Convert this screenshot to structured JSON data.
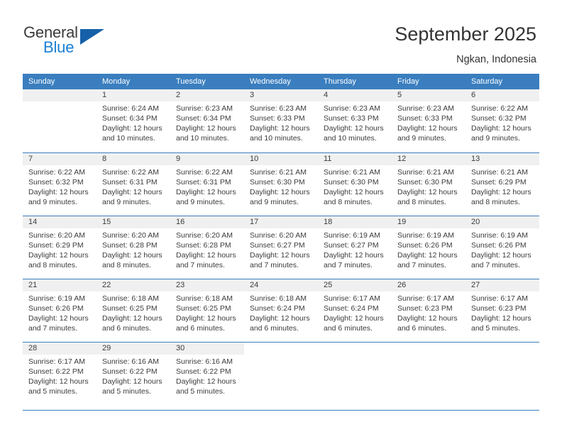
{
  "brand": {
    "name_part1": "General",
    "name_part2": "Blue",
    "accent_color": "#1560a8",
    "accent_text_color": "#1a7fd4"
  },
  "header": {
    "title": "September 2025",
    "location": "Ngkan, Indonesia"
  },
  "calendar": {
    "header_bg": "#3a7ebf",
    "daynum_bg": "#f0f0f0",
    "weekday_headers": [
      "Sunday",
      "Monday",
      "Tuesday",
      "Wednesday",
      "Thursday",
      "Friday",
      "Saturday"
    ],
    "weeks": [
      [
        {
          "day": "",
          "sunrise": "",
          "sunset": "",
          "daylight_line1": "",
          "daylight_line2": "",
          "empty": true
        },
        {
          "day": "1",
          "sunrise": "Sunrise: 6:24 AM",
          "sunset": "Sunset: 6:34 PM",
          "daylight_line1": "Daylight: 12 hours",
          "daylight_line2": "and 10 minutes."
        },
        {
          "day": "2",
          "sunrise": "Sunrise: 6:23 AM",
          "sunset": "Sunset: 6:34 PM",
          "daylight_line1": "Daylight: 12 hours",
          "daylight_line2": "and 10 minutes."
        },
        {
          "day": "3",
          "sunrise": "Sunrise: 6:23 AM",
          "sunset": "Sunset: 6:33 PM",
          "daylight_line1": "Daylight: 12 hours",
          "daylight_line2": "and 10 minutes."
        },
        {
          "day": "4",
          "sunrise": "Sunrise: 6:23 AM",
          "sunset": "Sunset: 6:33 PM",
          "daylight_line1": "Daylight: 12 hours",
          "daylight_line2": "and 10 minutes."
        },
        {
          "day": "5",
          "sunrise": "Sunrise: 6:23 AM",
          "sunset": "Sunset: 6:33 PM",
          "daylight_line1": "Daylight: 12 hours",
          "daylight_line2": "and 9 minutes."
        },
        {
          "day": "6",
          "sunrise": "Sunrise: 6:22 AM",
          "sunset": "Sunset: 6:32 PM",
          "daylight_line1": "Daylight: 12 hours",
          "daylight_line2": "and 9 minutes."
        }
      ],
      [
        {
          "day": "7",
          "sunrise": "Sunrise: 6:22 AM",
          "sunset": "Sunset: 6:32 PM",
          "daylight_line1": "Daylight: 12 hours",
          "daylight_line2": "and 9 minutes."
        },
        {
          "day": "8",
          "sunrise": "Sunrise: 6:22 AM",
          "sunset": "Sunset: 6:31 PM",
          "daylight_line1": "Daylight: 12 hours",
          "daylight_line2": "and 9 minutes."
        },
        {
          "day": "9",
          "sunrise": "Sunrise: 6:22 AM",
          "sunset": "Sunset: 6:31 PM",
          "daylight_line1": "Daylight: 12 hours",
          "daylight_line2": "and 9 minutes."
        },
        {
          "day": "10",
          "sunrise": "Sunrise: 6:21 AM",
          "sunset": "Sunset: 6:30 PM",
          "daylight_line1": "Daylight: 12 hours",
          "daylight_line2": "and 9 minutes."
        },
        {
          "day": "11",
          "sunrise": "Sunrise: 6:21 AM",
          "sunset": "Sunset: 6:30 PM",
          "daylight_line1": "Daylight: 12 hours",
          "daylight_line2": "and 8 minutes."
        },
        {
          "day": "12",
          "sunrise": "Sunrise: 6:21 AM",
          "sunset": "Sunset: 6:30 PM",
          "daylight_line1": "Daylight: 12 hours",
          "daylight_line2": "and 8 minutes."
        },
        {
          "day": "13",
          "sunrise": "Sunrise: 6:21 AM",
          "sunset": "Sunset: 6:29 PM",
          "daylight_line1": "Daylight: 12 hours",
          "daylight_line2": "and 8 minutes."
        }
      ],
      [
        {
          "day": "14",
          "sunrise": "Sunrise: 6:20 AM",
          "sunset": "Sunset: 6:29 PM",
          "daylight_line1": "Daylight: 12 hours",
          "daylight_line2": "and 8 minutes."
        },
        {
          "day": "15",
          "sunrise": "Sunrise: 6:20 AM",
          "sunset": "Sunset: 6:28 PM",
          "daylight_line1": "Daylight: 12 hours",
          "daylight_line2": "and 8 minutes."
        },
        {
          "day": "16",
          "sunrise": "Sunrise: 6:20 AM",
          "sunset": "Sunset: 6:28 PM",
          "daylight_line1": "Daylight: 12 hours",
          "daylight_line2": "and 7 minutes."
        },
        {
          "day": "17",
          "sunrise": "Sunrise: 6:20 AM",
          "sunset": "Sunset: 6:27 PM",
          "daylight_line1": "Daylight: 12 hours",
          "daylight_line2": "and 7 minutes."
        },
        {
          "day": "18",
          "sunrise": "Sunrise: 6:19 AM",
          "sunset": "Sunset: 6:27 PM",
          "daylight_line1": "Daylight: 12 hours",
          "daylight_line2": "and 7 minutes."
        },
        {
          "day": "19",
          "sunrise": "Sunrise: 6:19 AM",
          "sunset": "Sunset: 6:26 PM",
          "daylight_line1": "Daylight: 12 hours",
          "daylight_line2": "and 7 minutes."
        },
        {
          "day": "20",
          "sunrise": "Sunrise: 6:19 AM",
          "sunset": "Sunset: 6:26 PM",
          "daylight_line1": "Daylight: 12 hours",
          "daylight_line2": "and 7 minutes."
        }
      ],
      [
        {
          "day": "21",
          "sunrise": "Sunrise: 6:19 AM",
          "sunset": "Sunset: 6:26 PM",
          "daylight_line1": "Daylight: 12 hours",
          "daylight_line2": "and 7 minutes."
        },
        {
          "day": "22",
          "sunrise": "Sunrise: 6:18 AM",
          "sunset": "Sunset: 6:25 PM",
          "daylight_line1": "Daylight: 12 hours",
          "daylight_line2": "and 6 minutes."
        },
        {
          "day": "23",
          "sunrise": "Sunrise: 6:18 AM",
          "sunset": "Sunset: 6:25 PM",
          "daylight_line1": "Daylight: 12 hours",
          "daylight_line2": "and 6 minutes."
        },
        {
          "day": "24",
          "sunrise": "Sunrise: 6:18 AM",
          "sunset": "Sunset: 6:24 PM",
          "daylight_line1": "Daylight: 12 hours",
          "daylight_line2": "and 6 minutes."
        },
        {
          "day": "25",
          "sunrise": "Sunrise: 6:17 AM",
          "sunset": "Sunset: 6:24 PM",
          "daylight_line1": "Daylight: 12 hours",
          "daylight_line2": "and 6 minutes."
        },
        {
          "day": "26",
          "sunrise": "Sunrise: 6:17 AM",
          "sunset": "Sunset: 6:23 PM",
          "daylight_line1": "Daylight: 12 hours",
          "daylight_line2": "and 6 minutes."
        },
        {
          "day": "27",
          "sunrise": "Sunrise: 6:17 AM",
          "sunset": "Sunset: 6:23 PM",
          "daylight_line1": "Daylight: 12 hours",
          "daylight_line2": "and 5 minutes."
        }
      ],
      [
        {
          "day": "28",
          "sunrise": "Sunrise: 6:17 AM",
          "sunset": "Sunset: 6:22 PM",
          "daylight_line1": "Daylight: 12 hours",
          "daylight_line2": "and 5 minutes."
        },
        {
          "day": "29",
          "sunrise": "Sunrise: 6:16 AM",
          "sunset": "Sunset: 6:22 PM",
          "daylight_line1": "Daylight: 12 hours",
          "daylight_line2": "and 5 minutes."
        },
        {
          "day": "30",
          "sunrise": "Sunrise: 6:16 AM",
          "sunset": "Sunset: 6:22 PM",
          "daylight_line1": "Daylight: 12 hours",
          "daylight_line2": "and 5 minutes."
        },
        {
          "day": "",
          "sunrise": "",
          "sunset": "",
          "daylight_line1": "",
          "daylight_line2": "",
          "blank": true
        },
        {
          "day": "",
          "sunrise": "",
          "sunset": "",
          "daylight_line1": "",
          "daylight_line2": "",
          "blank": true
        },
        {
          "day": "",
          "sunrise": "",
          "sunset": "",
          "daylight_line1": "",
          "daylight_line2": "",
          "blank": true
        },
        {
          "day": "",
          "sunrise": "",
          "sunset": "",
          "daylight_line1": "",
          "daylight_line2": "",
          "blank": true
        }
      ]
    ]
  }
}
